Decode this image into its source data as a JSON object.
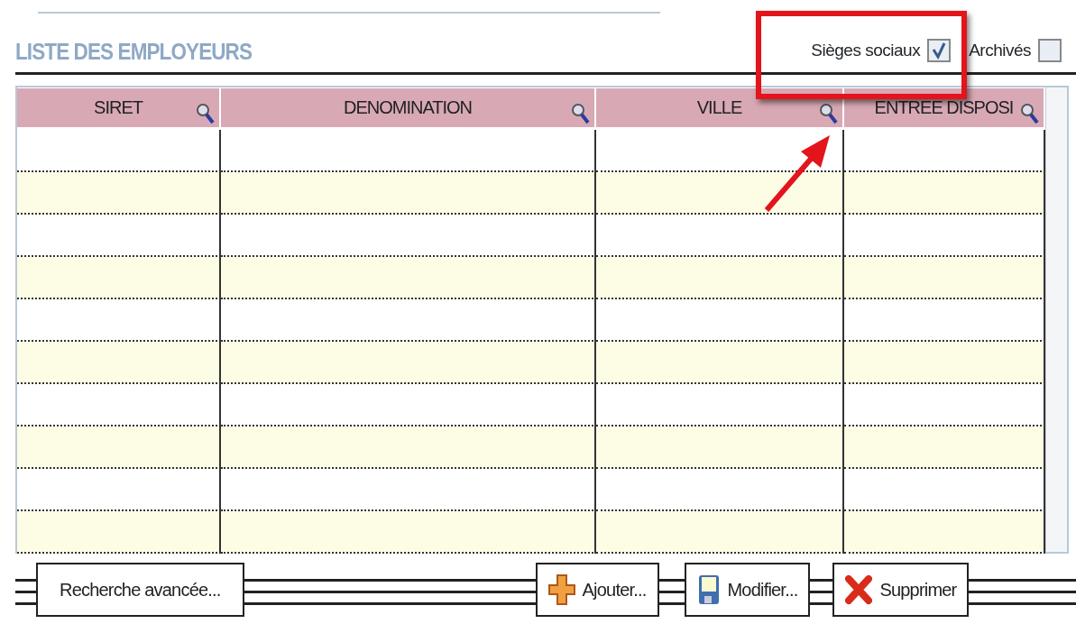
{
  "title": "LISTE DES EMPLOYEURS",
  "filters": [
    {
      "label": "Sièges sociaux",
      "checked": true
    },
    {
      "label": "Archivés",
      "checked": false
    }
  ],
  "table": {
    "columns": [
      {
        "label": "SIRET"
      },
      {
        "label": "DENOMINATION"
      },
      {
        "label": "VILLE"
      },
      {
        "label": "ENTREE DISPOSI"
      }
    ]
  },
  "buttons": [
    {
      "label": "Recherche avancée...",
      "kind": "plain"
    },
    {
      "label": "Ajouter...",
      "kind": "add"
    },
    {
      "label": "Modifier...",
      "kind": "edit"
    },
    {
      "label": "Supprimer",
      "kind": "delete"
    }
  ]
}
